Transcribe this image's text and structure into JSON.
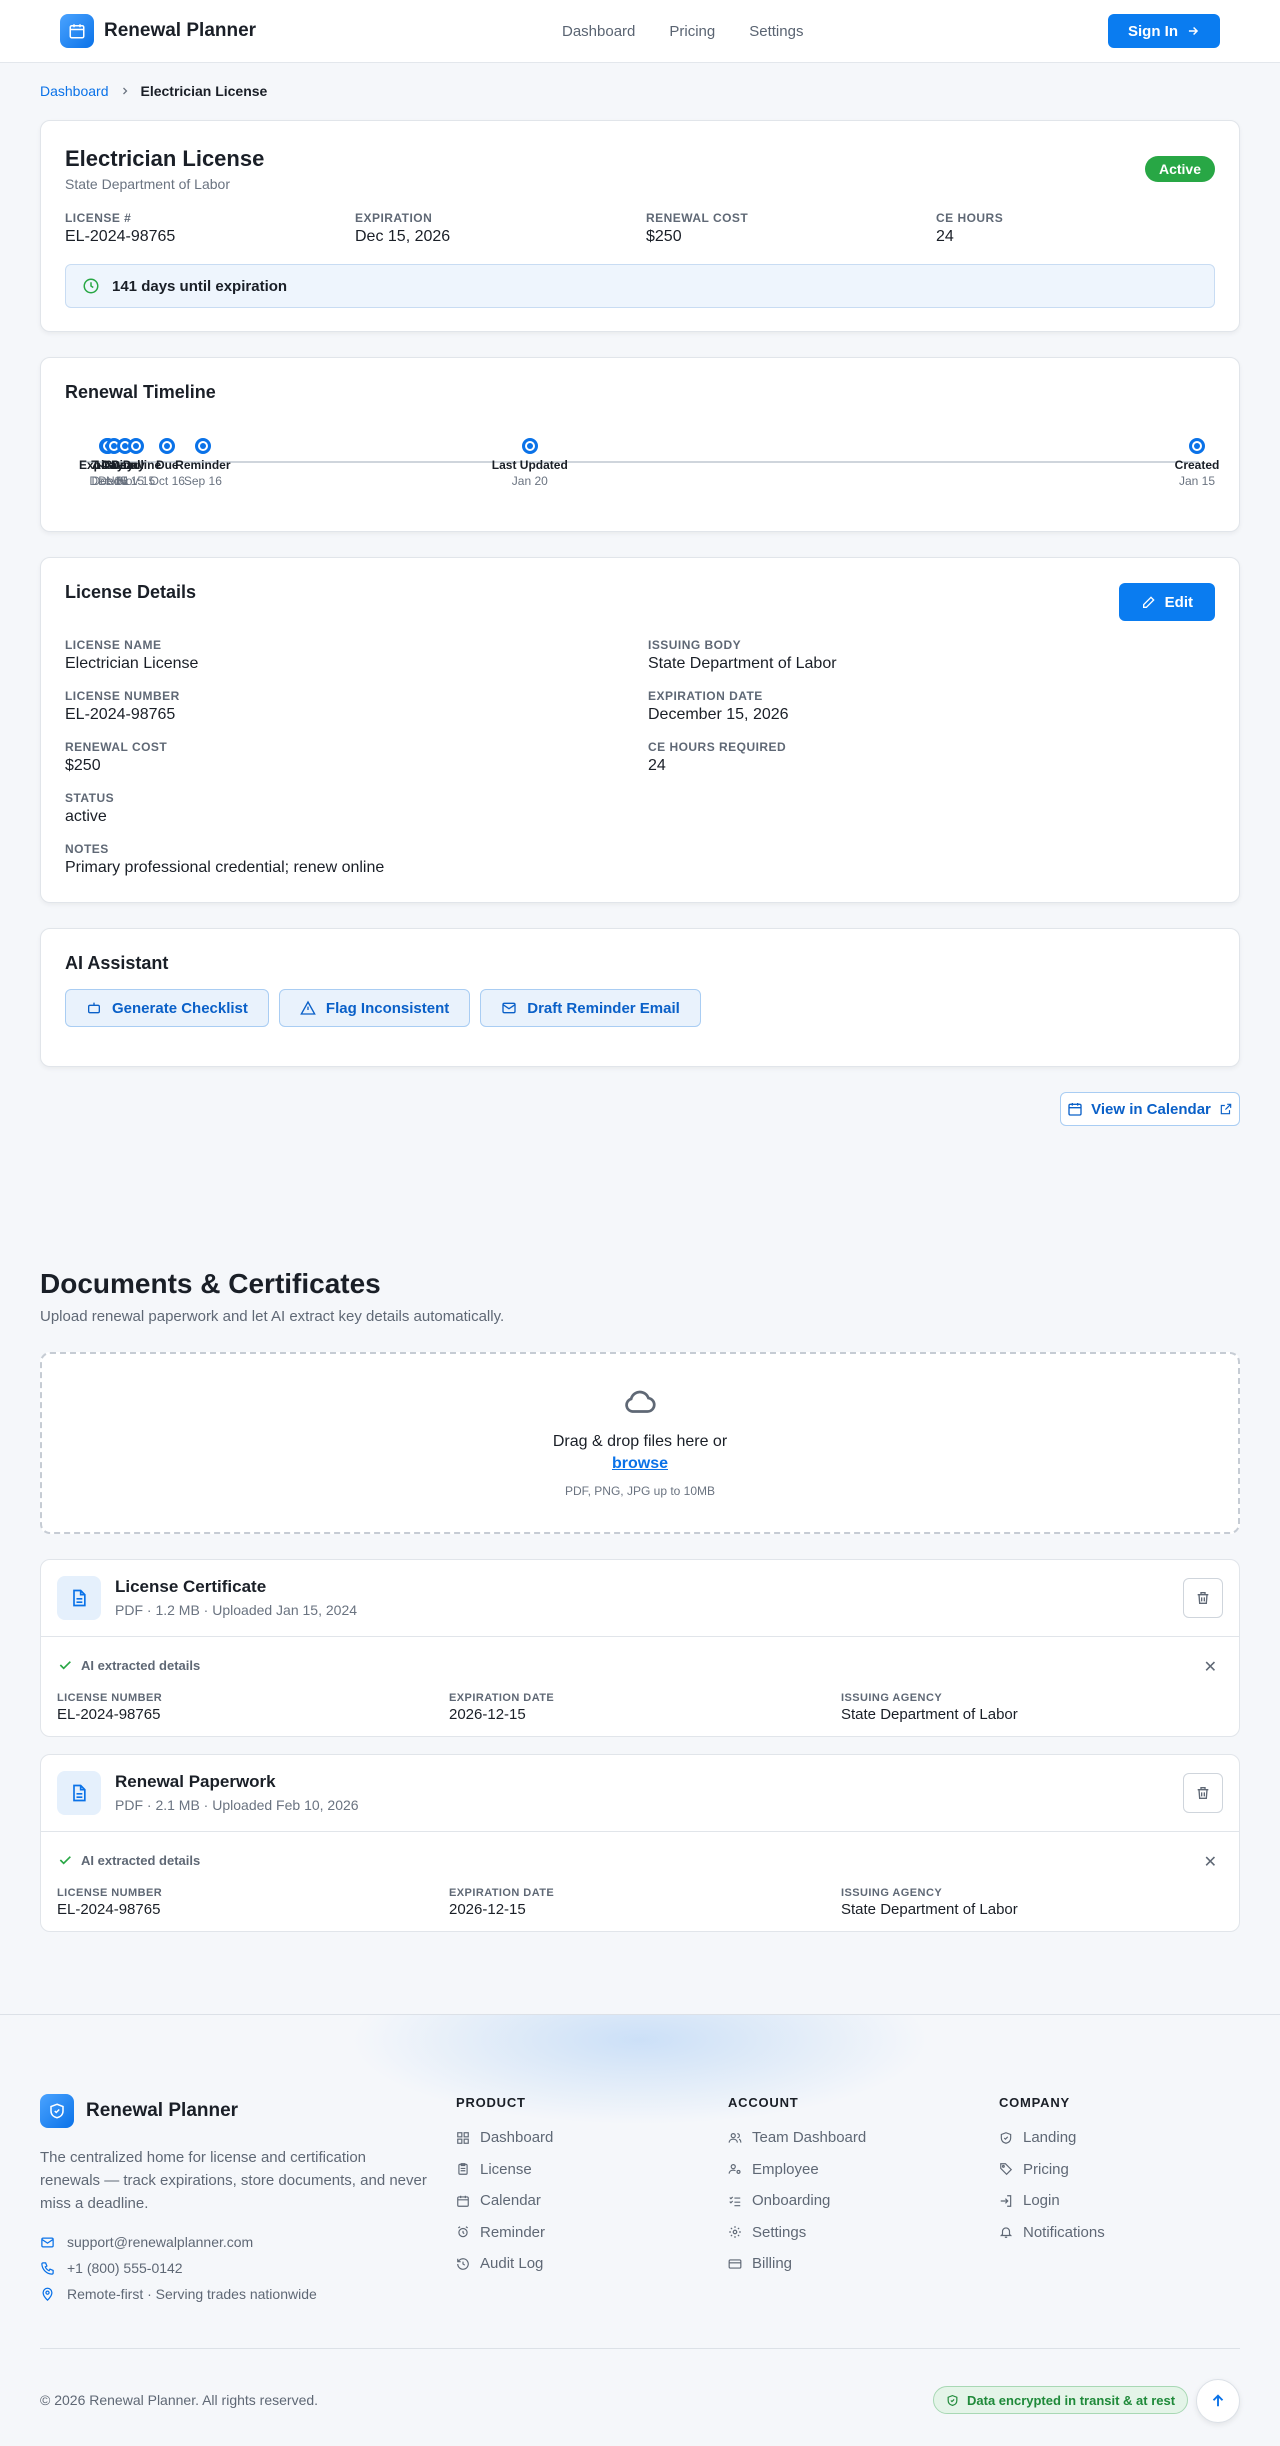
{
  "app": {
    "name": "Renewal Planner"
  },
  "nav": {
    "items": [
      "Dashboard",
      "Pricing",
      "Settings"
    ],
    "signin": "Sign In"
  },
  "breadcrumb": {
    "parent": "Dashboard",
    "current": "Electrician License"
  },
  "summary": {
    "title": "Electrician License",
    "issuer": "State Department of Labor",
    "status": "Active",
    "fields": [
      {
        "label": "License #",
        "value": "EL-2024-98765"
      },
      {
        "label": "Expiration",
        "value": "Dec 15, 2026"
      },
      {
        "label": "Renewal Cost",
        "value": "$250"
      },
      {
        "label": "CE Hours",
        "value": "24"
      }
    ],
    "countdown": "141 days until expiration"
  },
  "timeline": {
    "title": "Renewal Timeline",
    "points": [
      {
        "label": "7-Day",
        "date": "Dec 8",
        "pos": 0.02
      },
      {
        "label": "Expiration",
        "date": "Dec 15",
        "pos": 0.021
      },
      {
        "label": "14-Day",
        "date": "Dec 1",
        "pos": 0.026
      },
      {
        "label": "30-Day",
        "date": "Nov 15",
        "pos": 0.036
      },
      {
        "label": "Deadline",
        "date": "Nov 15",
        "pos": 0.046
      },
      {
        "label": "Due",
        "date": "Oct 16",
        "pos": 0.074
      },
      {
        "label": "Reminder",
        "date": "Sep 16",
        "pos": 0.106
      },
      {
        "label": "Last Updated",
        "date": "Jan 20",
        "pos": 0.4
      },
      {
        "label": "Created",
        "date": "Jan 15",
        "pos": 1.0
      }
    ]
  },
  "details": {
    "title": "License Details",
    "edit": "Edit",
    "left": [
      {
        "label": "License Name",
        "value": "Electrician License"
      },
      {
        "label": "License Number",
        "value": "EL-2024-98765"
      },
      {
        "label": "Renewal Cost",
        "value": "$250"
      },
      {
        "label": "Status",
        "value": "active"
      },
      {
        "label": "Notes",
        "value": "Primary professional credential; renew online"
      }
    ],
    "right": [
      {
        "label": "Issuing Body",
        "value": "State Department of Labor"
      },
      {
        "label": "Expiration Date",
        "value": "December 15, 2026"
      },
      {
        "label": "CE Hours Required",
        "value": "24"
      }
    ]
  },
  "ai": {
    "title": "AI Assistant",
    "buttons": [
      "Generate Checklist",
      "Flag Inconsistent",
      "Draft Reminder Email"
    ]
  },
  "calendar_btn": "View in Calendar",
  "documents": {
    "title": "Documents & Certificates",
    "subtitle": "Upload renewal paperwork and let AI extract key details automatically.",
    "drop_text": "Drag & drop files here or",
    "browse": "browse",
    "formats": "PDF, PNG, JPG up to 10MB",
    "ai_label": "AI extracted details",
    "items": [
      {
        "name": "License Certificate",
        "meta": "PDF · 1.2 MB · Uploaded Jan 15, 2024",
        "fields": [
          {
            "label": "License Number",
            "value": "EL-2024-98765"
          },
          {
            "label": "Expiration Date",
            "value": "2026-12-15"
          },
          {
            "label": "Issuing Agency",
            "value": "State Department of Labor"
          }
        ]
      },
      {
        "name": "Renewal Paperwork",
        "meta": "PDF · 2.1 MB · Uploaded Feb 10, 2026",
        "fields": [
          {
            "label": "License Number",
            "value": "EL-2024-98765"
          },
          {
            "label": "Expiration Date",
            "value": "2026-12-15"
          },
          {
            "label": "Issuing Agency",
            "value": "State Department of Labor"
          }
        ]
      }
    ]
  },
  "footer": {
    "brand": "Renewal Planner",
    "desc": "The centralized home for license and certification renewals — track expirations, store documents, and never miss a deadline.",
    "email": "support@renewalplanner.com",
    "phone": "+1 (800) 555-0142",
    "location": "Remote-first · Serving trades nationwide",
    "cols": [
      {
        "title": "Product",
        "items": [
          "Dashboard",
          "License",
          "Calendar",
          "Reminder",
          "Audit Log"
        ]
      },
      {
        "title": "Account",
        "items": [
          "Team Dashboard",
          "Employee",
          "Onboarding",
          "Settings",
          "Billing"
        ]
      },
      {
        "title": "Company",
        "items": [
          "Landing",
          "Pricing",
          "Login",
          "Notifications"
        ]
      }
    ],
    "copyright": "© 2026 Renewal Planner. All rights reserved.",
    "encrypted": "Data encrypted in transit & at rest"
  }
}
